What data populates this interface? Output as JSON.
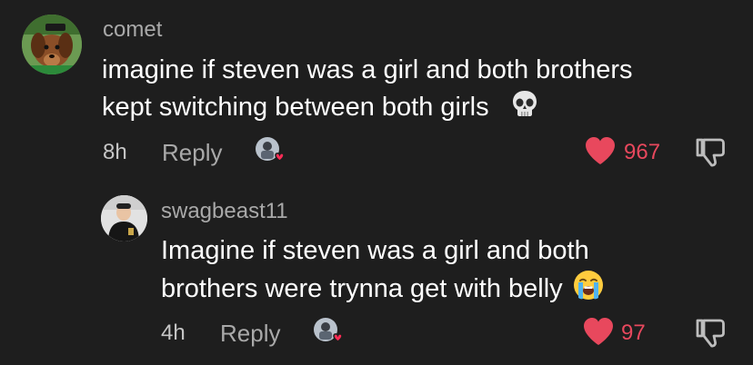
{
  "comments": [
    {
      "username": "comet",
      "text_line1": "imagine if steven was a girl and both brothers",
      "text_line2": "kept switching between both girls",
      "emoji": "skull-emoji",
      "time": "8h",
      "reply_label": "Reply",
      "likes": "967"
    },
    {
      "username": "swagbeast11",
      "text_line1": "Imagine if steven was a girl and both",
      "text_line2": "brothers were trynna get with belly",
      "emoji": "loudly-crying-emoji",
      "time": "4h",
      "reply_label": "Reply",
      "likes": "97"
    }
  ],
  "colors": {
    "background": "#1e1e1e",
    "username": "#a9a9a9",
    "text": "#ffffff",
    "like": "#e8485d",
    "meta": "#c6c6c6"
  }
}
